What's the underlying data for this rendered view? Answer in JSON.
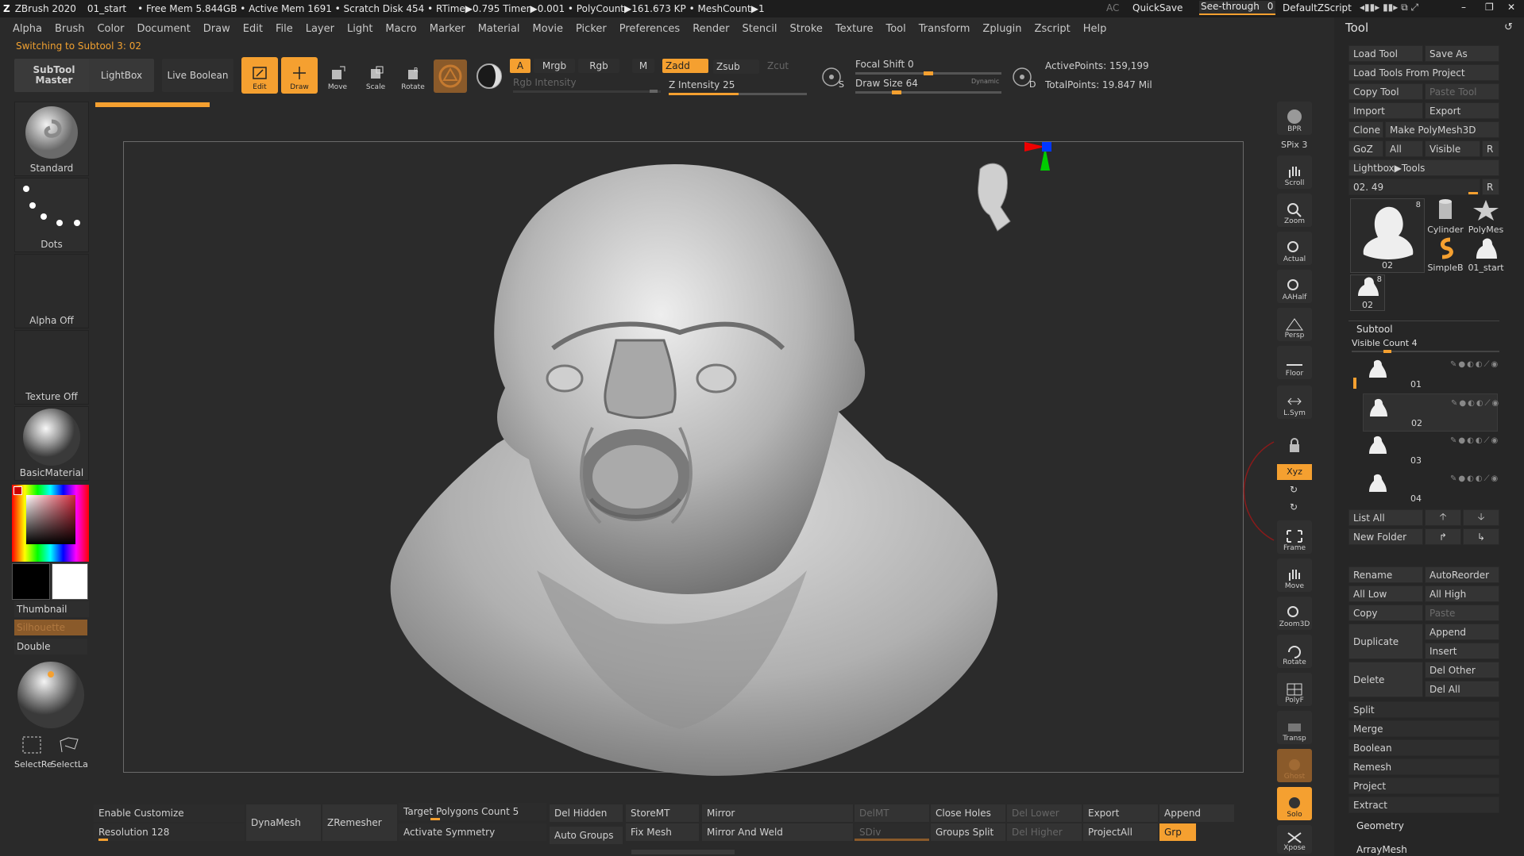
{
  "titlebar": {
    "app": "ZBrush 2020",
    "project": "01_start",
    "stats": "• Free Mem 5.844GB • Active Mem 1691 • Scratch Disk 454 • RTime▶0.795 Timer▶0.001 • PolyCount▶161.673 KP • MeshCount▶1",
    "ac": "AC",
    "quicksave": "QuickSave",
    "seethrough": "See-through",
    "seethrough_val": "0",
    "script": "DefaultZScript"
  },
  "menu": [
    "Alpha",
    "Brush",
    "Color",
    "Document",
    "Draw",
    "Edit",
    "File",
    "Layer",
    "Light",
    "Macro",
    "Marker",
    "Material",
    "Movie",
    "Picker",
    "Preferences",
    "Render",
    "Stencil",
    "Stroke",
    "Texture",
    "Tool",
    "Transform",
    "Zplugin",
    "Zscript",
    "Help"
  ],
  "status": "Switching to Subtool 3:  02",
  "toolbar": {
    "subtool_master": "SubTool Master",
    "lightbox": "LightBox",
    "live_boolean": "Live Boolean",
    "edit": "Edit",
    "draw": "Draw",
    "move": "Move",
    "scale": "Scale",
    "rotate": "Rotate",
    "a": "A",
    "mrgb": "Mrgb",
    "rgb": "Rgb",
    "m": "M",
    "zadd": "Zadd",
    "zsub": "Zsub",
    "zcut": "Zcut",
    "rgb_intensity": "Rgb Intensity",
    "z_intensity": "Z Intensity 25",
    "focal_shift": "Focal Shift 0",
    "draw_size": "Draw Size 64",
    "dynamic": "Dynamic",
    "active_points": "ActivePoints: 159,199",
    "total_points": "TotalPoints: 19.847 Mil",
    "s_label": "S",
    "d_label": "D"
  },
  "left": {
    "brush": "Standard",
    "stroke": "Dots",
    "alpha": "Alpha Off",
    "texture": "Texture Off",
    "material": "BasicMaterial",
    "thumbnail": "Thumbnail",
    "silhouette": "Silhouette",
    "double": "Double",
    "selectrect": "SelectRe",
    "selectlasso": "SelectLa"
  },
  "vtools": [
    "BPR",
    "SPix 3",
    "Scroll",
    "Zoom",
    "Actual",
    "AAHalf",
    "Persp",
    "Floor",
    "L.Sym",
    "",
    "Xyz",
    "",
    "",
    "Frame",
    "Move",
    "Zoom3D",
    "Rotate",
    "PolyF",
    "Transp",
    "Ghost",
    "Solo",
    "Xpose"
  ],
  "right": {
    "title": "Tool",
    "load_tool": "Load Tool",
    "save_as": "Save As",
    "load_from_project": "Load Tools From Project",
    "copy_tool": "Copy Tool",
    "paste_tool": "Paste Tool",
    "import": "Import",
    "export": "Export",
    "clone": "Clone",
    "make_polymesh": "Make PolyMesh3D",
    "goz": "GoZ",
    "all": "All",
    "visible": "Visible",
    "r": "R",
    "lightbox_tools": "Lightbox▶Tools",
    "tool_slider": "02. 49",
    "thumbs": [
      "02",
      "Cylinder",
      "PolyMes",
      "SimpleB",
      "01_start",
      "02"
    ],
    "thumb_badge": "8",
    "subtool": "Subtool",
    "visible_count": "Visible Count 4",
    "subtools": [
      "01",
      "02",
      "03",
      "04"
    ],
    "list_all": "List All",
    "new_folder": "New Folder",
    "rename": "Rename",
    "autoreorder": "AutoReorder",
    "all_low": "All Low",
    "all_high": "All High",
    "copy": "Copy",
    "paste": "Paste",
    "duplicate": "Duplicate",
    "append": "Append",
    "insert": "Insert",
    "delete": "Delete",
    "del_other": "Del Other",
    "del_all": "Del All",
    "sections": [
      "Split",
      "Merge",
      "Boolean",
      "Remesh",
      "Project",
      "Extract"
    ],
    "geometry": "Geometry",
    "arraymesh": "ArrayMesh"
  },
  "bottom": {
    "enable_customize": "Enable Customize",
    "resolution": "Resolution 128",
    "dynamesh": "DynaMesh",
    "zremesher": "ZRemesher",
    "target_polys": "Target Polygons Count 5",
    "activate_symmetry": "Activate Symmetry",
    "del_hidden": "Del Hidden",
    "auto_groups": "Auto Groups",
    "storemt": "StoreMT",
    "fix_mesh": "Fix Mesh",
    "mirror": "Mirror",
    "mirror_weld": "Mirror And Weld",
    "delmt": "DelMT",
    "sdiv": "SDiv",
    "close_holes": "Close Holes",
    "groups_split": "Groups Split",
    "del_lower": "Del Lower",
    "del_higher": "Del Higher",
    "export": "Export",
    "projectall": "ProjectAll",
    "append": "Append",
    "grp": "Grp"
  },
  "colors": {
    "accent": "#f5a030",
    "bg": "#2a2a2a",
    "panel": "#262626"
  }
}
